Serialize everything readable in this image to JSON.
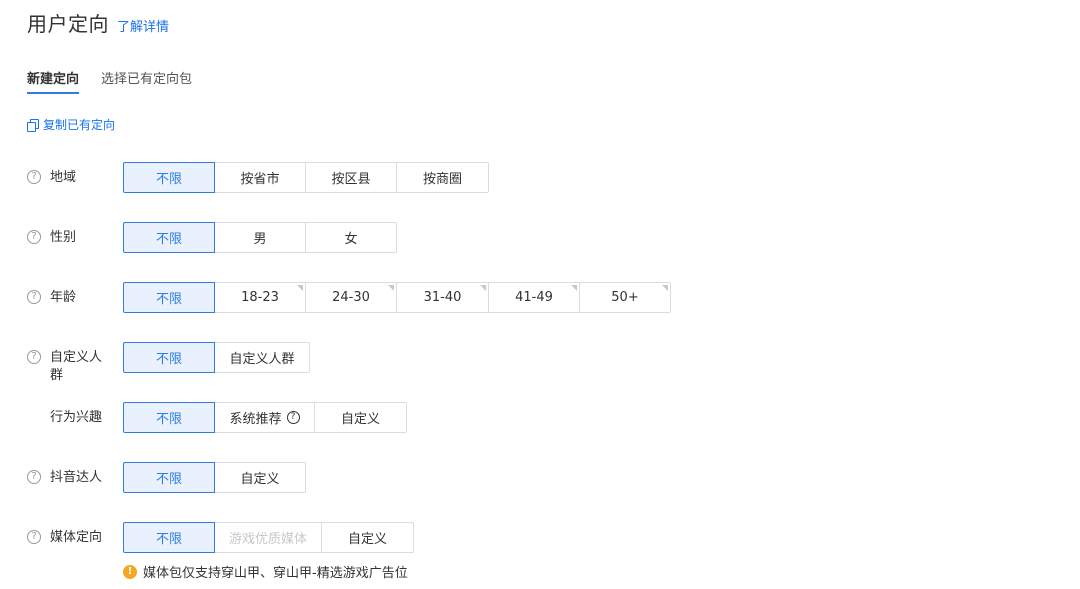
{
  "header": {
    "title": "用户定向",
    "learn_more": "了解详情"
  },
  "tabs": [
    {
      "label": "新建定向",
      "active": true
    },
    {
      "label": "选择已有定向包",
      "active": false
    }
  ],
  "copy_link": "复制已有定向",
  "accent_color": "#2f7de1",
  "rows": {
    "region": {
      "label": "地域",
      "options": [
        "不限",
        "按省市",
        "按区县",
        "按商圈"
      ],
      "selected": "不限"
    },
    "gender": {
      "label": "性别",
      "options": [
        "不限",
        "男",
        "女"
      ],
      "selected": "不限"
    },
    "age": {
      "label": "年龄",
      "options": [
        "不限",
        "18-23",
        "24-30",
        "31-40",
        "41-49",
        "50+"
      ],
      "selected": "不限"
    },
    "custom_audience": {
      "label": "自定义人群",
      "options": [
        "不限",
        "自定义人群"
      ],
      "selected": "不限"
    },
    "behavior": {
      "label": "行为兴趣",
      "options": [
        "不限",
        "系统推荐",
        "自定义"
      ],
      "selected": "不限"
    },
    "douyin": {
      "label": "抖音达人",
      "options": [
        "不限",
        "自定义"
      ],
      "selected": "不限"
    },
    "media": {
      "label": "媒体定向",
      "options": [
        "不限",
        "游戏优质媒体",
        "自定义"
      ],
      "selected": "不限",
      "disabled": [
        "游戏优质媒体"
      ]
    }
  },
  "note": "媒体包仅支持穿山甲、穿山甲-精选游戏广告位"
}
